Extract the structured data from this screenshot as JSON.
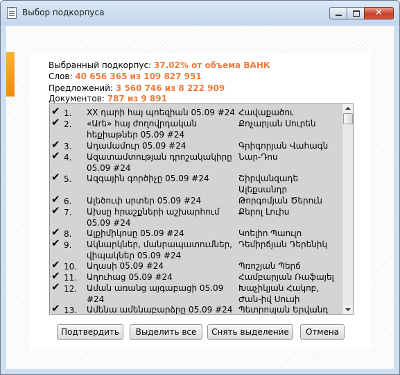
{
  "window": {
    "title": "Выбор подкорпуса",
    "close_glyph": "✕"
  },
  "info": {
    "subcorpus_label": "Выбранный подкорпус: ",
    "subcorpus_value": "37.02% от объема ВАНК",
    "words_label": "Слов: ",
    "words_value": "40 656 365 из 109 827 951",
    "sentences_label": "Предложений: ",
    "sentences_value": "3 560 746 из 8 222 909",
    "documents_label": "Документов: ",
    "documents_value": "787 из 9 891"
  },
  "list": {
    "check_glyph": "✔",
    "rows": [
      {
        "num": "1.",
        "title": "XX դարի հայ պոեզիան 05.09 #24",
        "author": "Հավաքածու",
        "checked": true
      },
      {
        "num": "2.",
        "title": "«Աrե» հայ ժողովրդական հեքիաթներ 05.09 #24",
        "author": "Քոչարյան Սուրեն",
        "checked": true
      },
      {
        "num": "3.",
        "title": "Ադամամուր 05.09 #24",
        "author": "Գրիգորյան Վահագն",
        "checked": true
      },
      {
        "num": "4.",
        "title": "Ազատամտության դրոշակակիրը 05.09 #24",
        "author": "Նար-Դոս",
        "checked": true
      },
      {
        "num": "5.",
        "title": "Ազգային գործիչը 05.09 #24",
        "author": "Շիրվանզադե Ալեքսանդր",
        "checked": true
      },
      {
        "num": "6.",
        "title": "Ալեծուփ սրտեր 05.09 #24",
        "author": "Թորգոմյան Ծերուն",
        "checked": true
      },
      {
        "num": "7.",
        "title": "Ախսը հրաշքների աշխարհում 05.09 #24",
        "author": "Քերոլ Լուիս",
        "checked": true
      },
      {
        "num": "8.",
        "title": "Ալքիմիկոսը 05.09 #24",
        "author": "Կոելիո Պաուլո",
        "checked": true
      },
      {
        "num": "9.",
        "title": "Ակնարկներ, մանրապատումներ, վիպակներ 05.09 #24",
        "author": "Դեմիրճյան Դերենիկ",
        "checked": true
      },
      {
        "num": "10.",
        "title": "Աղասի 05.09 #24",
        "author": "Պռոշյան Պերճ",
        "checked": true
      },
      {
        "num": "11.",
        "title": "Աղուհաց 05.09 #24",
        "author": "Համբարյան Ռաֆայել",
        "checked": true
      },
      {
        "num": "12.",
        "title": "Աման առանց այգաբացի 05.09 #24",
        "author": "Խաչիկյան Հակոբ, Ժան-իվ Սուսի",
        "checked": true
      },
      {
        "num": "13.",
        "title": "Ամենա ամենաբարձրը 05.09 #24",
        "author": "Պետրոսյան Երվանդ",
        "checked": true
      }
    ]
  },
  "buttons": {
    "confirm": "Подтвердить",
    "select_all": "Выделить все",
    "deselect": "Снять выделение",
    "cancel": "Отмена"
  }
}
